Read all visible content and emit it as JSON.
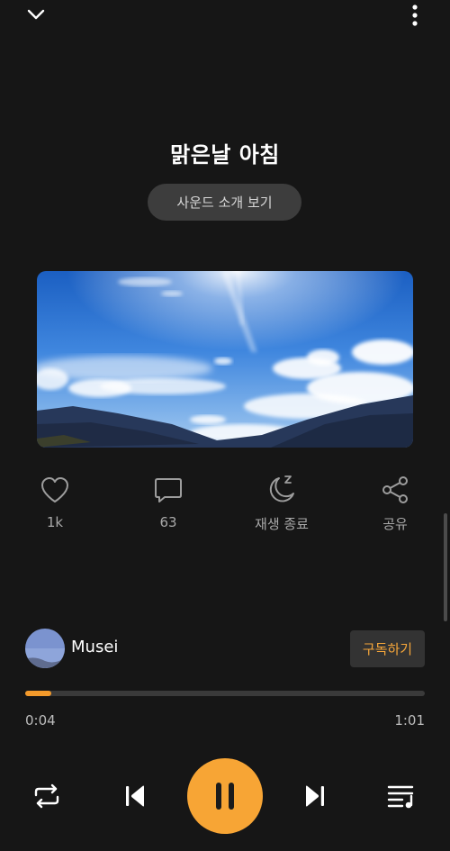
{
  "header": {
    "collapse_icon": "chevron-down-icon",
    "more_icon": "more-vertical-icon"
  },
  "track": {
    "title": "맑은날 아침",
    "intro_button": "사운드 소개 보기",
    "artwork": "sky-landscape-image"
  },
  "actions": [
    {
      "icon": "heart-icon",
      "label": "1k"
    },
    {
      "icon": "comment-icon",
      "label": "63"
    },
    {
      "icon": "sleep-timer-icon",
      "label": "재생 종료"
    },
    {
      "icon": "share-icon",
      "label": "공유"
    }
  ],
  "artist": {
    "name": "Musei",
    "subscribe_label": "구독하기"
  },
  "playback": {
    "elapsed": "0:04",
    "duration": "1:01",
    "progress": 0.066
  },
  "controls": {
    "repeat_icon": "repeat-icon",
    "previous_icon": "skip-previous-icon",
    "pause_icon": "pause-icon",
    "next_icon": "skip-next-icon",
    "playlist_icon": "playlist-icon"
  },
  "colors": {
    "background": "#161616",
    "accent": "#f7a535",
    "subscribe_text": "#f6a63a"
  }
}
